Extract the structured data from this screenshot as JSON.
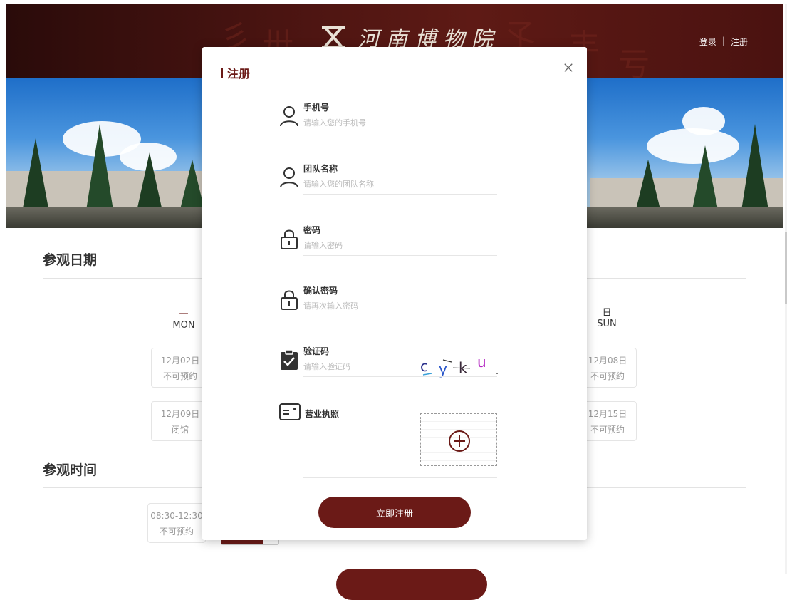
{
  "colors": {
    "brand": "#6b1a17",
    "header_dark": "#2a0b0a",
    "placeholder": "#bbbbbb"
  },
  "header": {
    "logo_icon": "museum-logo-icon",
    "logo_text": "河南博物院",
    "login_label": "登录",
    "separator": "|",
    "register_label": "注册"
  },
  "page": {
    "visit_date_title": "参观日期",
    "visit_time_title": "参观时间",
    "weekdays": [
      {
        "zh": "一",
        "en": "MON"
      },
      {
        "zh": "日",
        "en": "SUN"
      }
    ],
    "date_cards": [
      {
        "date": "12月02日",
        "status": "不可预约"
      },
      {
        "date": "12月08日",
        "status": "不可预约"
      },
      {
        "date": "12月09日",
        "status": "闭馆"
      },
      {
        "date": "12月15日",
        "status": "不可预约"
      }
    ],
    "time_cards": [
      {
        "time": "08:30-12:30",
        "status": "不可预约"
      }
    ]
  },
  "modal": {
    "title": "注册",
    "close_icon": "close-icon",
    "fields": {
      "phone": {
        "label": "手机号",
        "placeholder": "请输入您的手机号",
        "value": "",
        "icon": "user-icon"
      },
      "team": {
        "label": "团队名称",
        "placeholder": "请输入您的团队名称",
        "value": "",
        "icon": "user-icon"
      },
      "password": {
        "label": "密码",
        "placeholder": "请输入密码",
        "value": "",
        "icon": "lock-icon"
      },
      "confirm": {
        "label": "确认密码",
        "placeholder": "请再次输入密码",
        "value": "",
        "icon": "lock-icon"
      },
      "captcha": {
        "label": "验证码",
        "placeholder": "请输入验证码",
        "value": "",
        "icon": "clipboard-check-icon",
        "image_chars": [
          "c",
          "y",
          "k",
          "u"
        ]
      },
      "license": {
        "label": "营业执照",
        "icon": "id-card-icon",
        "upload_icon": "plus-circle-icon"
      }
    },
    "submit_label": "立即注册"
  }
}
